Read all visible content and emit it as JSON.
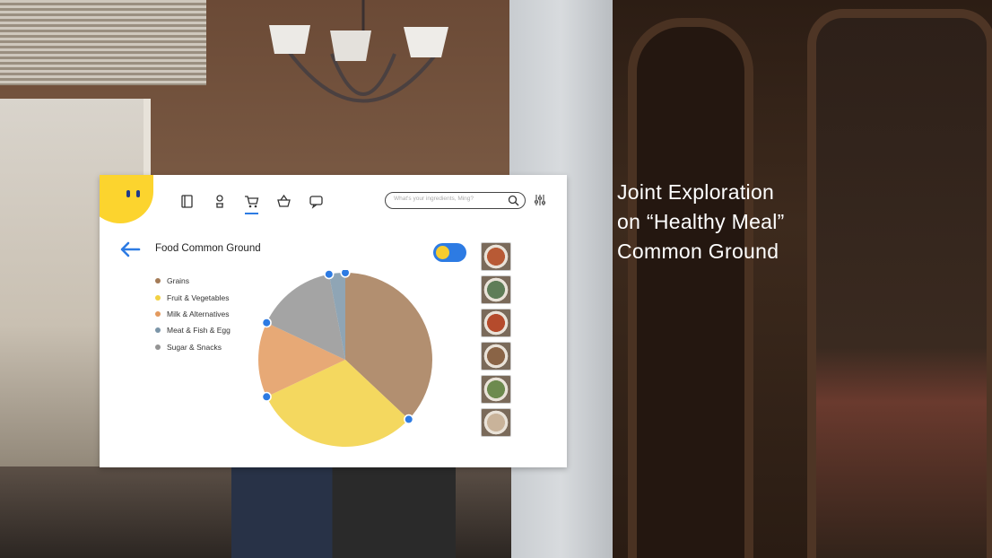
{
  "caption": {
    "line1": "Joint Exploration",
    "line2": "on “Healthy Meal”",
    "line3": "Common Ground"
  },
  "app": {
    "nav": [
      {
        "icon": "recipe-book-icon",
        "active": false
      },
      {
        "icon": "chef-icon",
        "active": false
      },
      {
        "icon": "cart-icon",
        "active": true
      },
      {
        "icon": "basket-icon",
        "active": false
      },
      {
        "icon": "chat-icon",
        "active": false
      }
    ],
    "search": {
      "placeholder": "What's your ingredients, Ming?"
    },
    "page_title": "Food Common Ground",
    "toggle_on": true
  },
  "colors": {
    "accent_blue": "#2d7be3",
    "brand_yellow": "#fcd42e"
  },
  "chart_data": {
    "type": "pie",
    "title": "",
    "legend_position": "left",
    "series": [
      {
        "name": "Grains",
        "color": "#a47b57",
        "value": 37
      },
      {
        "name": "Fruit & Vegetables",
        "color": "#f2d143",
        "value": 31
      },
      {
        "name": "Milk & Alternatives",
        "color": "#e39a5e",
        "value": 14
      },
      {
        "name": "Meat & Fish & Egg",
        "color": "#7b95a8",
        "value": 3
      },
      {
        "name": "Sugar & Snacks",
        "color": "#949494",
        "value": 15
      }
    ],
    "draw_order": [
      "Grains",
      "Fruit & Vegetables",
      "Milk & Alternatives",
      "Sugar & Snacks",
      "Meat & Fish & Egg"
    ]
  },
  "thumbnails": [
    {
      "icon": "soup-bowl-thumbnail",
      "color": "#b85a35"
    },
    {
      "icon": "salad-thumbnail",
      "color": "#5f7d58"
    },
    {
      "icon": "tomato-dish-thumbnail",
      "color": "#b54b2c"
    },
    {
      "icon": "noodle-soup-thumbnail",
      "color": "#8a6446"
    },
    {
      "icon": "greens-dish-thumbnail",
      "color": "#6d8a4e"
    },
    {
      "icon": "dumplings-thumbnail",
      "color": "#c9b39a"
    }
  ]
}
